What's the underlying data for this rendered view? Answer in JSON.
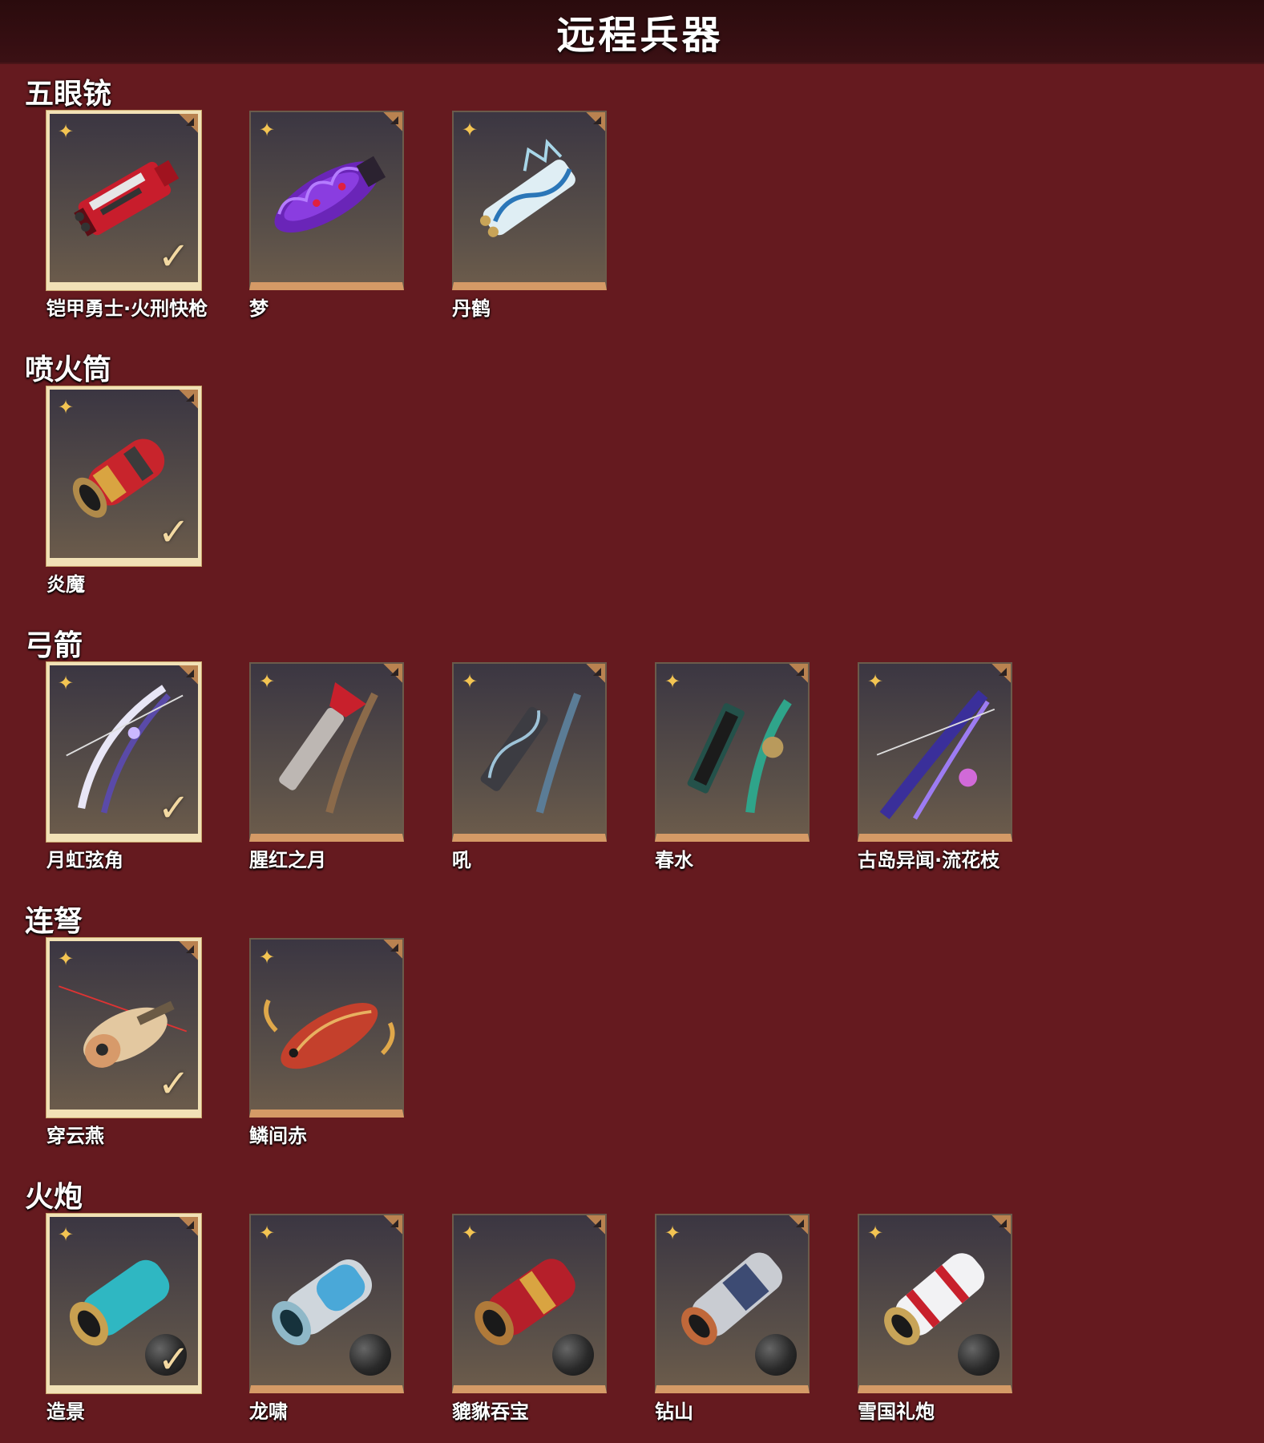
{
  "header": {
    "title": "远程兵器"
  },
  "sections": [
    {
      "title": "五眼铳",
      "items": [
        {
          "name": "铠甲勇士·火刑快枪",
          "equipped": true
        },
        {
          "name": "梦",
          "equipped": false
        },
        {
          "name": "丹鹤",
          "equipped": false
        }
      ]
    },
    {
      "title": "喷火筒",
      "items": [
        {
          "name": "炎魔",
          "equipped": true
        }
      ]
    },
    {
      "title": "弓箭",
      "items": [
        {
          "name": "月虹弦角",
          "equipped": true
        },
        {
          "name": "腥红之月",
          "equipped": false
        },
        {
          "name": "吼",
          "equipped": false
        },
        {
          "name": "春水",
          "equipped": false
        },
        {
          "name": "古岛异闻·流花枝",
          "equipped": false
        }
      ]
    },
    {
      "title": "连弩",
      "items": [
        {
          "name": "穿云燕",
          "equipped": true
        },
        {
          "name": "鳞间赤",
          "equipped": false
        }
      ]
    },
    {
      "title": "火炮",
      "items": [
        {
          "name": "造景",
          "equipped": true
        },
        {
          "name": "龙啸",
          "equipped": false
        },
        {
          "name": "貔貅吞宝",
          "equipped": false
        },
        {
          "name": "钻山",
          "equipped": false
        },
        {
          "name": "雪国礼炮",
          "equipped": false
        }
      ]
    }
  ],
  "icons": {
    "rarity": "star-emblem-icon",
    "equipped": "checkmark-icon",
    "corner": "corner-tag-icon"
  },
  "colors": {
    "background": "#651a1f",
    "header": "#2a0b0d",
    "card_border_equipped": "#f1e1b6",
    "card_bottom": "#d59a66",
    "star": "#f3c452"
  }
}
